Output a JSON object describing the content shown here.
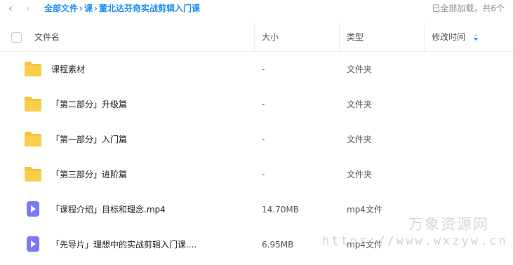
{
  "nav": {
    "back_glyph": "‹",
    "forward_glyph": "›",
    "breadcrumbs": [
      "全部文件",
      "课"
    ],
    "separator": "›",
    "current": "董北达芬奇实战剪辑入门课",
    "status": "已全部加载，共6个"
  },
  "header": {
    "name": "文件名",
    "size": "大小",
    "type": "类型",
    "modified": "修改时间"
  },
  "rows": [
    {
      "name": "课程素材",
      "size": "-",
      "type": "文件夹",
      "icon": "folder-icon"
    },
    {
      "name": "「第二部分」升级篇",
      "size": "-",
      "type": "文件夹",
      "icon": "folder-icon"
    },
    {
      "name": "「第一部分」入门篇",
      "size": "-",
      "type": "文件夹",
      "icon": "folder-icon"
    },
    {
      "name": "「第三部分」进阶篇",
      "size": "-",
      "type": "文件夹",
      "icon": "folder-icon"
    },
    {
      "name": "「课程介绍」目标和理念.mp4",
      "size": "14.70MB",
      "type": "mp4文件",
      "icon": "video-icon"
    },
    {
      "name": "「先导片」理想中的实战剪辑入门课....",
      "size": "6.95MB",
      "type": "mp4文件",
      "icon": "video-icon"
    }
  ],
  "watermark": {
    "title": "万象资源网",
    "url": "https://www.wxzyw.cn"
  },
  "colors": {
    "accent": "#1e8ef5",
    "folder": "#f7c242",
    "video": "#7b79f4"
  }
}
